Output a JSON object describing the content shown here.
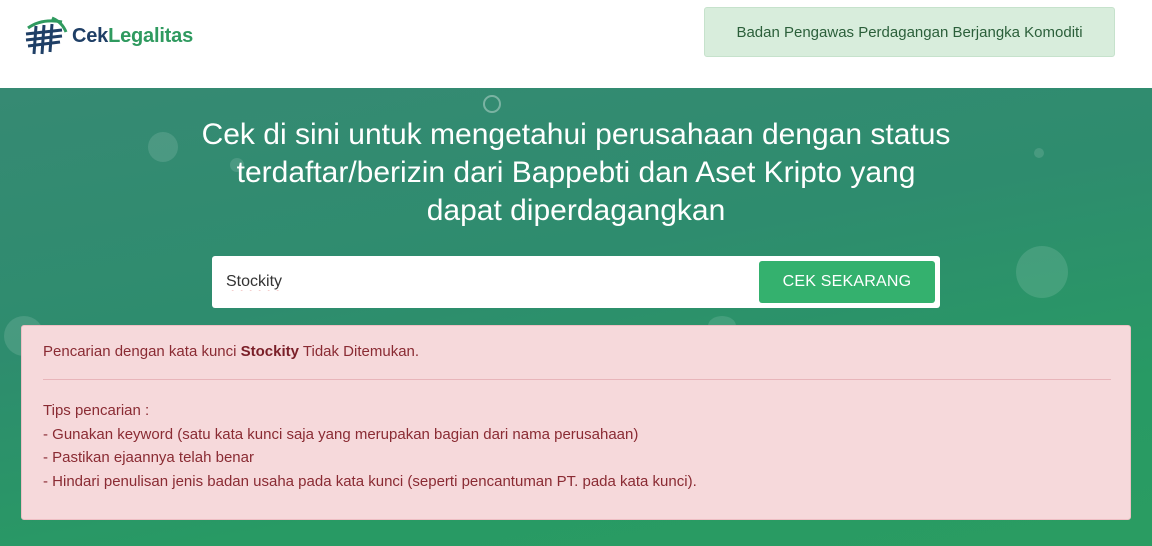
{
  "header": {
    "logo_part1": "Cek",
    "logo_part2": "Legalitas",
    "agency_name": "Badan Pengawas Perdagangan Berjangka Komoditi"
  },
  "hero": {
    "headline": "Cek di sini untuk mengetahui perusahaan dengan status terdaftar/berizin dari Bappebti dan Aset Kripto yang dapat diperdagangkan"
  },
  "search": {
    "value": "Stockity",
    "button_label": "CEK SEKARANG"
  },
  "alert": {
    "prefix": "Pencarian dengan kata kunci ",
    "keyword": "Stockity",
    "suffix": " Tidak Ditemukan.",
    "tips_title": "Tips pencarian :",
    "tips": [
      "- Gunakan keyword (satu kata kunci saja yang merupakan bagian dari nama perusahaan)",
      "- Pastikan ejaannya telah benar",
      "- Hindari penulisan jenis badan usaha pada kata kunci (seperti pencantuman PT. pada kata kunci)."
    ]
  },
  "colors": {
    "accent_green": "#34b16e",
    "alert_bg": "#f6d9db",
    "alert_text": "#8a2b33"
  }
}
